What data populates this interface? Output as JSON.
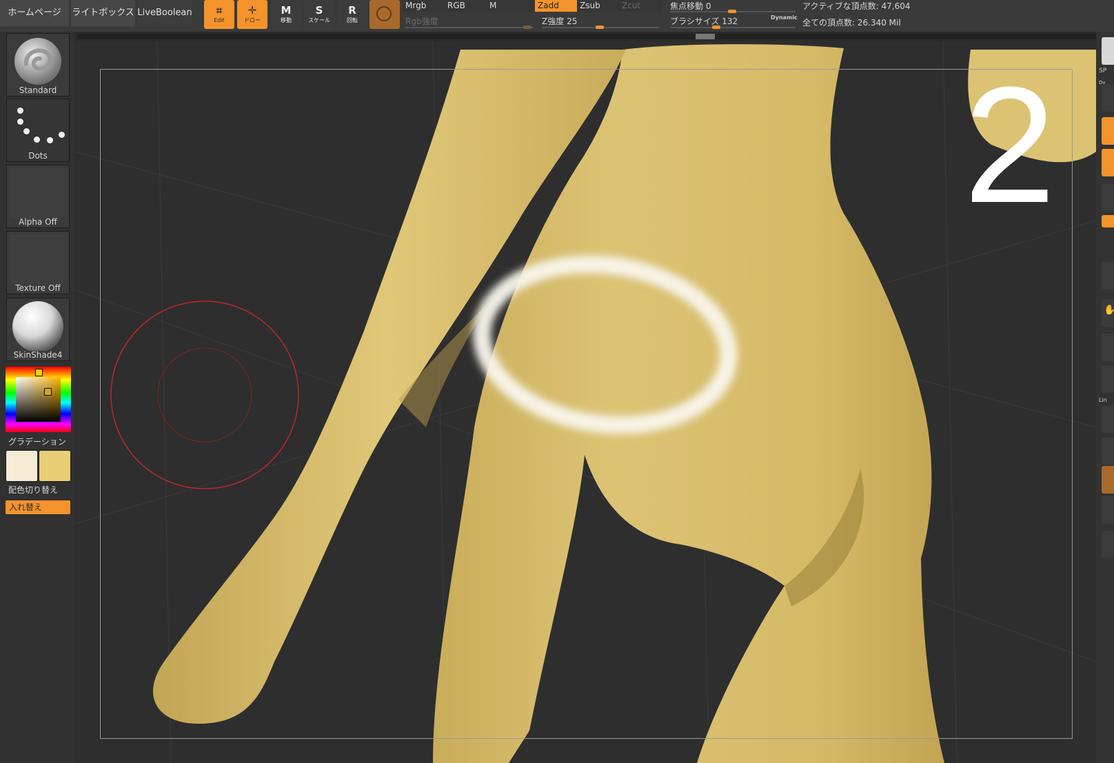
{
  "nav": {
    "home": "ホームページ",
    "lightbox": "ライトボックス",
    "liveboolean": "LiveBoolean"
  },
  "tools": {
    "edit": "Edit",
    "draw": "ドロー",
    "move": "移動",
    "scale": "スケール",
    "rotate": "回転",
    "move_glyph": "M",
    "scale_glyph": "S",
    "rotate_glyph": "R"
  },
  "modes": {
    "mrgb": "Mrgb",
    "rgb": "RGB",
    "m": "M",
    "zadd": "Zadd",
    "zsub": "Zsub",
    "zcut": "Zcut"
  },
  "sliders": {
    "rgb_intensity_label": "Rgb強度",
    "rgb_intensity_value": "",
    "z_intensity_label": "Z強度",
    "z_intensity_value": "25",
    "focal_shift_label": "焦点移動",
    "focal_shift_value": "0",
    "draw_size_label": "ブラシサイズ",
    "draw_size_value": "132",
    "dynamic_label": "Dynamic"
  },
  "stats": {
    "active_points": "アクティブな頂点数: 47,604",
    "total_points": "全ての頂点数: 26.340 Mil"
  },
  "shelf": {
    "brush": "Standard",
    "stroke": "Dots",
    "alpha": "Alpha Off",
    "texture": "Texture Off",
    "material": "SkinShade4",
    "gradient": "グラデーション",
    "switch_color": "配色切り替え",
    "swap": "入れ替え"
  },
  "colors": {
    "accent": "#f4932c",
    "model": "#d8bf6d",
    "main_color": "#e8cf75",
    "secondary_color": "#f6ecd4",
    "brush_circle": "#cc2222"
  },
  "overlay": {
    "step_number": "2"
  },
  "right_shelf": {
    "spix": "SP",
    "dynamic": "Dy",
    "line": "Lin"
  }
}
